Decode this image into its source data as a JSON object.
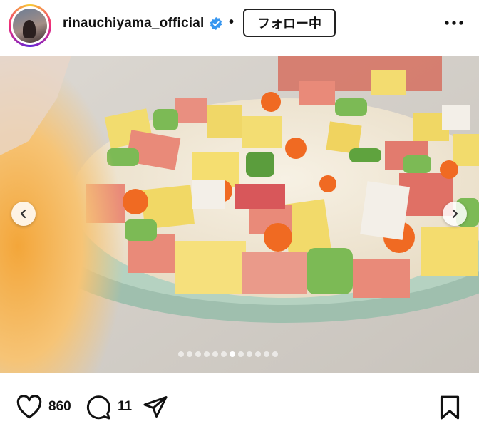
{
  "header": {
    "username": "rinauchiyama_official",
    "verified": true,
    "separator": "•",
    "follow_label": "フォロー中",
    "more_icon": "more-horizontal-icon"
  },
  "post": {
    "image_subject": "chirashi-sushi platter",
    "carousel": {
      "total": 12,
      "active_index": 7
    },
    "prev_icon": "chevron-left-icon",
    "next_icon": "chevron-right-icon"
  },
  "actions": {
    "like_count": "860",
    "comment_count": "11",
    "like_icon": "heart-icon",
    "comment_icon": "comment-icon",
    "share_icon": "share-icon",
    "save_icon": "bookmark-icon"
  },
  "colors": {
    "verified": "#3897f0",
    "text": "#111111",
    "dot_active": "#ffffff"
  }
}
